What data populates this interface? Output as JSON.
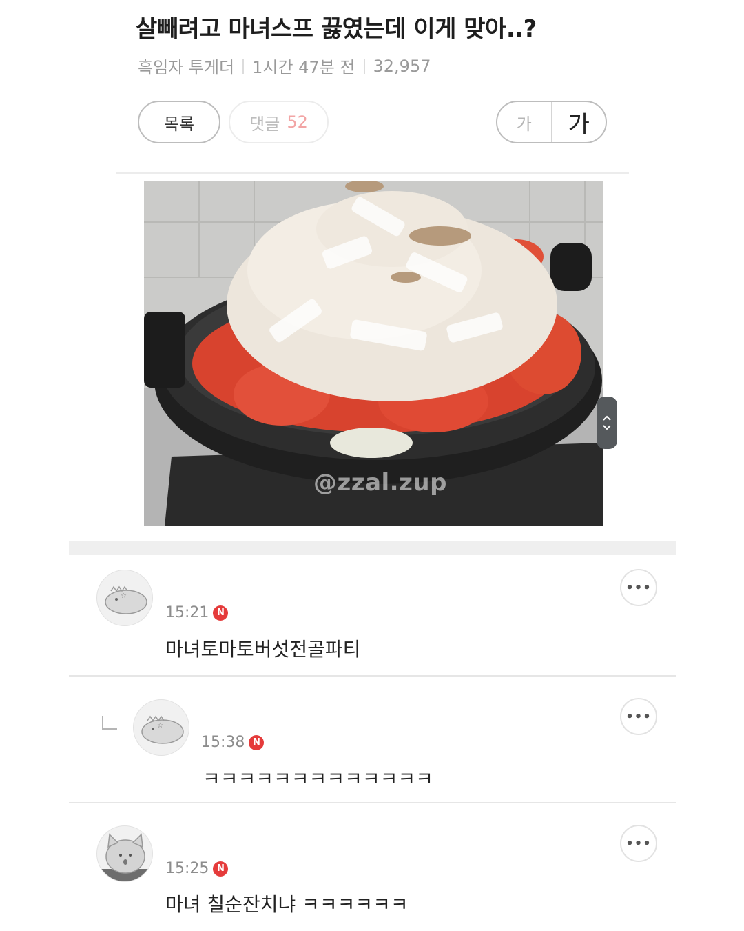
{
  "post": {
    "title": "살빼려고 마녀스프 끓였는데 이게 맞아..?",
    "author": "흑임자 투게더",
    "time_ago": "1시간 47분 전",
    "views": "32,957"
  },
  "toolbar": {
    "list_label": "목록",
    "comments_label": "댓글",
    "comments_count": "52",
    "font_small_label": "가",
    "font_large_label": "가"
  },
  "image": {
    "watermark": "@zzal.zup"
  },
  "comments": [
    {
      "author": "",
      "time": "15:21",
      "badge": "N",
      "text": "마녀토마토버섯전골파티",
      "is_reply": false
    },
    {
      "author": "",
      "time": "15:38",
      "badge": "N",
      "text": "ㅋㅋㅋㅋㅋㅋㅋㅋㅋㅋㅋㅋㅋ",
      "is_reply": true
    },
    {
      "author": "",
      "time": "15:25",
      "badge": "N",
      "text": "마녀 칠순잔치냐 ㅋㅋㅋㅋㅋㅋ",
      "is_reply": false
    }
  ],
  "icons": {
    "more": "more-options-icon",
    "reply": "reply-arrow-icon",
    "scroll": "scroll-updown-icon"
  },
  "colors": {
    "new_badge": "#e53b3b",
    "comment_count": "#f2a5a5"
  }
}
